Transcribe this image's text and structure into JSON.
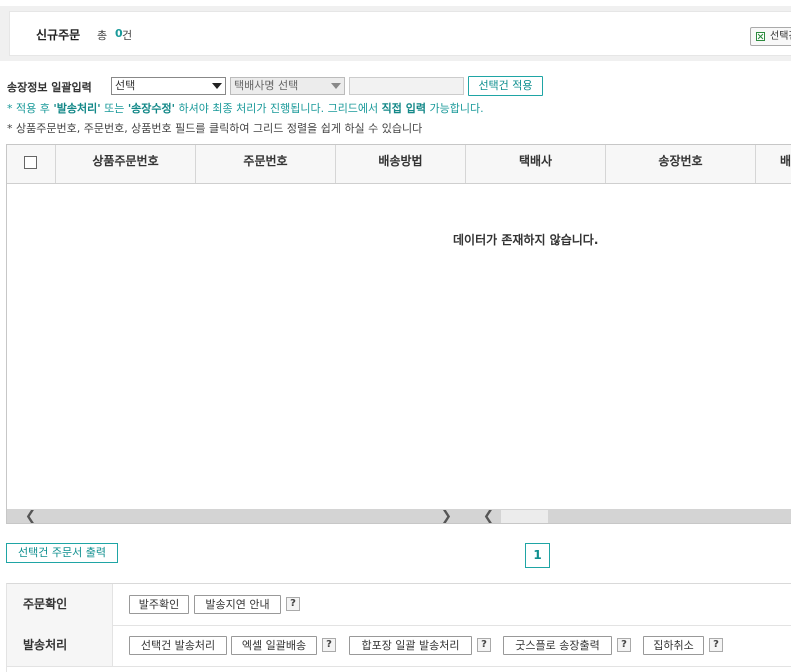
{
  "summary": {
    "title": "신규주문",
    "total_label": "총",
    "count": "0",
    "unit": "건",
    "excel_button": "선택건"
  },
  "bulk_input": {
    "label": "송장정보 일괄입력",
    "status_select": "선택",
    "courier_select": "택배사명 선택",
    "tracking_value": "",
    "apply_button": "선택건 적용"
  },
  "notices": {
    "n1_prefix": "* 적용 후 ",
    "n1_emph1": "'발송처리'",
    "n1_mid1": " 또는 ",
    "n1_emph2": "'송장수정'",
    "n1_mid2": " 하셔야 최종 처리가 진행됩니다. 그리드에서 ",
    "n1_emph3": "직접 입력",
    "n1_suffix": " 가능합니다.",
    "n2": "* 상품주문번호, 주문번호, 상품번호 필드를 클릭하여 그리드 정렬을 쉽게 하실 수 있습니다"
  },
  "grid": {
    "columns": [
      "상품주문번호",
      "주문번호",
      "배송방법",
      "택배사",
      "송장번호",
      "배"
    ],
    "empty_message": "데이터가 존재하지 않습니다."
  },
  "footer": {
    "print_button": "선택건 주문서 출력",
    "current_page": "1"
  },
  "actions": {
    "row1": {
      "label": "주문확인",
      "buttons": [
        "발주확인",
        "발송지연 안내"
      ],
      "help": "?"
    },
    "row2": {
      "label": "발송처리",
      "buttons": [
        "선택건 발송처리",
        "엑셀 일괄배송",
        "합포장 일괄 발송처리",
        "굿스플로 송장출력",
        "집하취소"
      ],
      "help": "?"
    }
  },
  "colors": {
    "accent": "#1a9a9a",
    "border": "#c7c7c7"
  }
}
